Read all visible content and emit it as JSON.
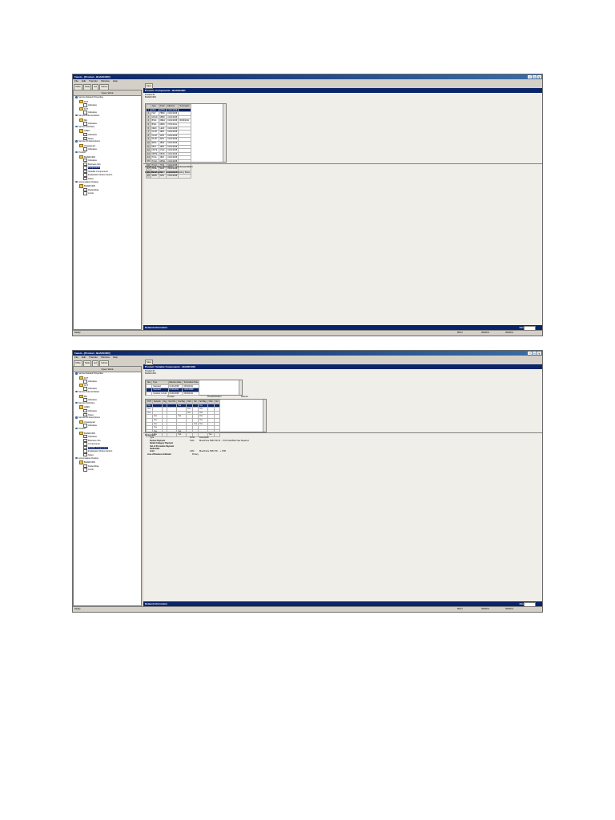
{
  "app": {
    "title": "Facets - [Product - BHARC30D]",
    "menu": [
      "File",
      "Edit",
      "Transfer",
      "Window",
      "Help"
    ],
    "toolbar": [
      "Office",
      "Tasks",
      "Ext",
      "Submit"
    ],
    "save_label": "Save",
    "tree_tab": "Open Work",
    "related_label": "Related Information",
    "find_label": "Find",
    "status_ready": "Ready",
    "status_cells": [
      "MSCI",
      "06/30/11",
      "06/30/11"
    ]
  },
  "tree": [
    {
      "label": "Service Related Properties",
      "icon": "group",
      "indent": 0
    },
    {
      "label": "DVT",
      "icon": "folder",
      "indent": 1
    },
    {
      "label": "Indicative",
      "icon": "doc",
      "indent": 2
    },
    {
      "label": "DVT",
      "icon": "folder",
      "indent": 1
    },
    {
      "label": "Indicative",
      "icon": "doc",
      "indent": 2
    },
    {
      "label": "Service Rule Definition",
      "icon": "group",
      "indent": 0
    },
    {
      "label": "MH",
      "icon": "folder",
      "indent": 1
    },
    {
      "label": "Indicative",
      "icon": "doc",
      "indent": 2
    },
    {
      "label": "Service Definition",
      "icon": "group",
      "indent": 0
    },
    {
      "label": "ADEC",
      "icon": "folder",
      "indent": 1
    },
    {
      "label": "Indicative",
      "icon": "doc",
      "indent": 2
    },
    {
      "label": "Notes",
      "icon": "doc",
      "indent": 2
    },
    {
      "label": "Service ID Descriptions",
      "icon": "group",
      "indent": 0
    },
    {
      "label": "Unassigned",
      "icon": "folder",
      "indent": 1
    },
    {
      "label": "Indicative",
      "icon": "doc",
      "indent": 2
    },
    {
      "label": "Product",
      "icon": "group",
      "indent": 0
    },
    {
      "label": "BHARC30D",
      "icon": "folder",
      "indent": 1
    },
    {
      "label": "Indicative",
      "icon": "doc",
      "indent": 2
    },
    {
      "label": "Business Info",
      "icon": "doc",
      "indent": 2
    },
    {
      "label": "Components",
      "icon": "doc",
      "indent": 2
    },
    {
      "label": "Variable Components",
      "icon": "doc",
      "indent": 2
    },
    {
      "label": "Explanation Rules Factors",
      "icon": "doc",
      "indent": 2
    },
    {
      "label": "Notes",
      "icon": "doc",
      "indent": 2
    },
    {
      "label": "Accumulators Display",
      "icon": "group",
      "indent": 0
    },
    {
      "label": "BHARC30D",
      "icon": "folder",
      "indent": 1
    },
    {
      "label": "Deductibles",
      "icon": "doc",
      "indent": 2
    },
    {
      "label": "Limits",
      "icon": "doc",
      "indent": 2
    }
  ],
  "screen1": {
    "header": "Product: Components - BHARC30D",
    "product_id_label": "Product ID",
    "product_id": "BHARC30D",
    "columns": [
      "Type",
      "Prefix",
      "Effective",
      "Termination"
    ],
    "rows": [
      [
        "DEN",
        "MAB1",
        "01/01/2008",
        ""
      ],
      [
        "HAV",
        "HB00",
        "01/01/2008",
        ""
      ],
      [
        "MAAR",
        "MB00",
        "01/01/2008",
        ""
      ],
      [
        "BSIG",
        "DBE4",
        "01/01/2008",
        "06/30/2011"
      ],
      [
        "BSIG",
        "DB09",
        "07/01/2011",
        ""
      ],
      [
        "DEDI",
        "LE00",
        "01/01/2008",
        ""
      ],
      [
        "CLAH",
        "1800",
        "01/01/2008",
        ""
      ],
      [
        "CLAH",
        "1400",
        "01/01/2008",
        ""
      ],
      [
        "DLUH",
        "3400",
        "01/01/2008",
        ""
      ],
      [
        "EBCL",
        "1B00",
        "01/01/2008",
        ""
      ],
      [
        "MFG",
        "1800",
        "01/01/2008",
        ""
      ],
      [
        "NOTE",
        "C910",
        "01/01/2008",
        ""
      ],
      [
        "MPHE",
        "MF00",
        "01/01/2008",
        ""
      ],
      [
        "PCAL",
        "1800",
        "01/01/2008",
        ""
      ],
      [
        "PCAC",
        "MHE1",
        "01/01/2008",
        ""
      ],
      [
        "PCDC",
        "7T00",
        "01/01/2008",
        ""
      ],
      [
        "PDSL",
        "1400",
        "01/01/2008",
        ""
      ],
      [
        "PDSP",
        "TM03",
        "01/01/2008",
        ""
      ],
      [
        "SERV",
        "0400",
        "01/01/2008",
        ""
      ]
    ],
    "detail": {
      "type_desc_label": "Component Type Description",
      "type_desc": "Data Amount Rules",
      "prefix_desc_label": "Prefix Description",
      "prefix_desc": "Hospital/Ambulatory Rules"
    }
  },
  "screen2": {
    "header": "Product: Variable Components - BHARC30D",
    "product_id_label": "Product ID",
    "product_id": "BHARC30D",
    "top_columns": [
      "Site",
      "Type",
      "Effective Date",
      "Termination Date"
    ],
    "top_rows": [
      [
        "",
        "Standard",
        "01/01/2008",
        "06/30/2011"
      ],
      [
        "",
        "Standard",
        "07/01/2011",
        "12/31/9999"
      ],
      [
        "",
        "Accident or Auto",
        "01/01/2008",
        "06/30/2011"
      ]
    ],
    "group_headers": [
      "Provider",
      "Preauthorization",
      "Referral"
    ],
    "bottom_columns": [
      "PCP",
      "Network",
      "Ctg",
      "Non Par",
      "Not Bag",
      "Obtn",
      "Not",
      "Not Bag",
      "Obtn",
      "Not"
    ],
    "bottom_rows": [
      [
        "Yes",
        "",
        "",
        "",
        "Yes",
        "",
        "",
        "Yes",
        "",
        ""
      ],
      [
        "Yes",
        "",
        "",
        "",
        "",
        "Yes",
        "",
        "Yes",
        "",
        ""
      ],
      [
        "Yes",
        "",
        "",
        "",
        "",
        "Yes",
        "",
        "Yes",
        "",
        ""
      ],
      [
        "",
        "Yes",
        "",
        "",
        "Yes",
        "",
        "",
        "Yes",
        "",
        ""
      ],
      [
        "",
        "Yes",
        "",
        "",
        "",
        "",
        "",
        "Yes",
        "",
        ""
      ],
      [
        "",
        "Yes",
        "",
        "",
        "",
        "",
        "Yes",
        "Yes",
        "",
        ""
      ],
      [
        "",
        "Yes",
        "",
        "",
        "",
        "",
        "",
        "",
        "",
        ""
      ],
      [
        "",
        "Yes",
        "",
        "",
        "Yes",
        "",
        "",
        "",
        "",
        ""
      ],
      [
        "",
        "Yes",
        "",
        "",
        "Yes",
        "",
        "",
        "",
        "Yes",
        ""
      ]
    ],
    "detail": {
      "component_label": "Component",
      "col_type": "Type",
      "col_prefix": "Prefix",
      "col_desc": "Description",
      "items": [
        {
          "label": "Service Payment",
          "prefix": "S110",
          "desc": "BlueChoice HMO HD 4X ... PCP visits/Plan/Year Required"
        },
        {
          "label": "Dental Category Payment",
          "prefix": "",
          "desc": ""
        },
        {
          "label": "Out of Procedure Payment",
          "prefix": "",
          "desc": ""
        },
        {
          "label": "Deductible",
          "prefix": "",
          "desc": ""
        },
        {
          "label": "Limit",
          "prefix": "L450",
          "desc": "BlueChoice HMO HD ... + HCB"
        }
      ],
      "lob_label": "Line of Business Indicator",
      "lob_value": "Privacy"
    }
  }
}
